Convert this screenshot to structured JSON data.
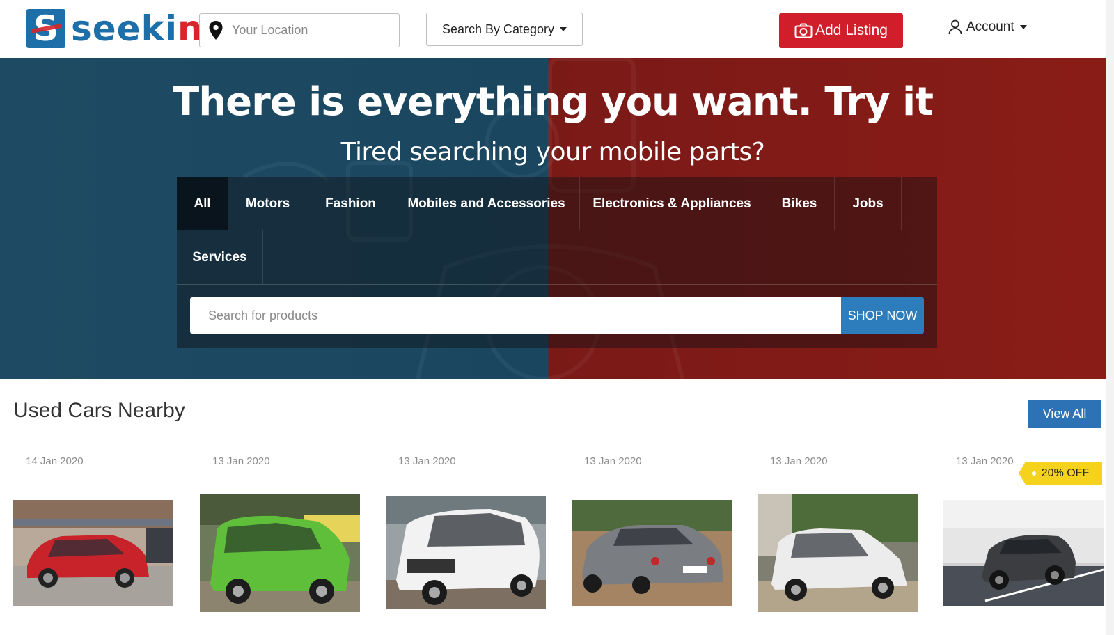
{
  "header": {
    "logo_text_a": "seeki",
    "logo_text_b": "n",
    "location_placeholder": "Your Location",
    "category_label": "Search By Category",
    "add_listing_label": "Add Listing",
    "account_label": "Account"
  },
  "hero": {
    "title": "There is everything you want. Try it",
    "subtitle": "Tired searching your mobile parts?",
    "tabs": [
      {
        "label": "All",
        "active": true
      },
      {
        "label": "Motors"
      },
      {
        "label": "Fashion"
      },
      {
        "label": "Mobiles and Accessories"
      },
      {
        "label": "Electronics & Appliances"
      },
      {
        "label": "Bikes"
      },
      {
        "label": "Jobs"
      },
      {
        "label": "Services"
      }
    ],
    "search_placeholder": "Search for products",
    "shop_now_label": "SHOP NOW",
    "colors": {
      "left": "#1a4660",
      "right": "#8a1c17"
    }
  },
  "listings": {
    "title": "Used Cars Nearby",
    "view_all_label": "View All",
    "items": [
      {
        "date": "14 Jan 2020",
        "car_color": "#c8232b",
        "bg": "street"
      },
      {
        "date": "13 Jan 2020",
        "car_color": "#5fbf3b",
        "bg": "yard"
      },
      {
        "date": "13 Jan 2020",
        "car_color": "#f2f2f2",
        "bg": "street"
      },
      {
        "date": "13 Jan 2020",
        "car_color": "#7a7d82",
        "bg": "dirt"
      },
      {
        "date": "13 Jan 2020",
        "car_color": "#ececec",
        "bg": "trees"
      },
      {
        "date": "13 Jan 2020",
        "car_color": "#3b3d40",
        "bg": "lot",
        "badge": "20% OFF"
      }
    ]
  },
  "accent": {
    "brand_blue": "#1c6fa8",
    "brand_red": "#d01f2a",
    "button_blue": "#2d72b4",
    "badge_yellow": "#f5d31d"
  }
}
